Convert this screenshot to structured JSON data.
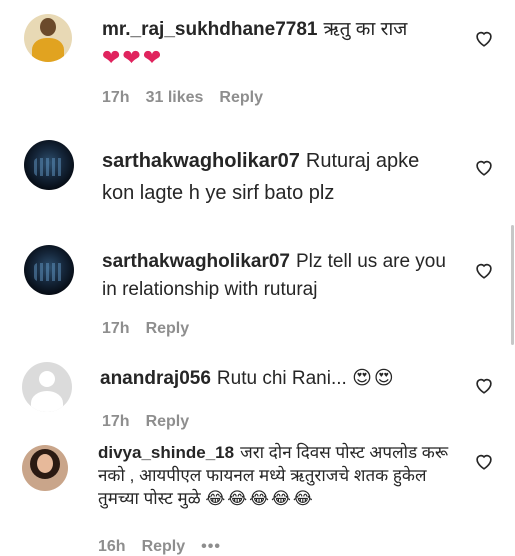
{
  "comments": [
    {
      "username": "mr._raj_sukhdhane7781",
      "text": "ऋतु का राज",
      "emojis": "❤❤❤",
      "time": "17h",
      "likes": "31 likes",
      "reply": "Reply"
    },
    {
      "username": "sarthakwagholikar07",
      "text": "Ruturaj apke kon lagte h ye sirf bato plz"
    },
    {
      "username": "sarthakwagholikar07",
      "text": "Plz tell us are you in relationship with ruturaj",
      "time": "17h",
      "reply": "Reply"
    },
    {
      "username": "anandraj056",
      "text": "Rutu chi Rani...",
      "emojis": "😍😍",
      "time": "17h",
      "reply": "Reply"
    },
    {
      "username": "divya_shinde_18",
      "text": "जरा दोन दिवस पोस्ट अपलोड करू नको , आयपीएल फायनल मध्ये ऋतुराजचे शतक हुकेल तुमच्या पोस्ट मुळे",
      "emojis": "😂😂😂😂😂",
      "time": "16h",
      "reply": "Reply",
      "more": "•••"
    }
  ],
  "icons": {
    "like": "heart-outline-icon"
  }
}
